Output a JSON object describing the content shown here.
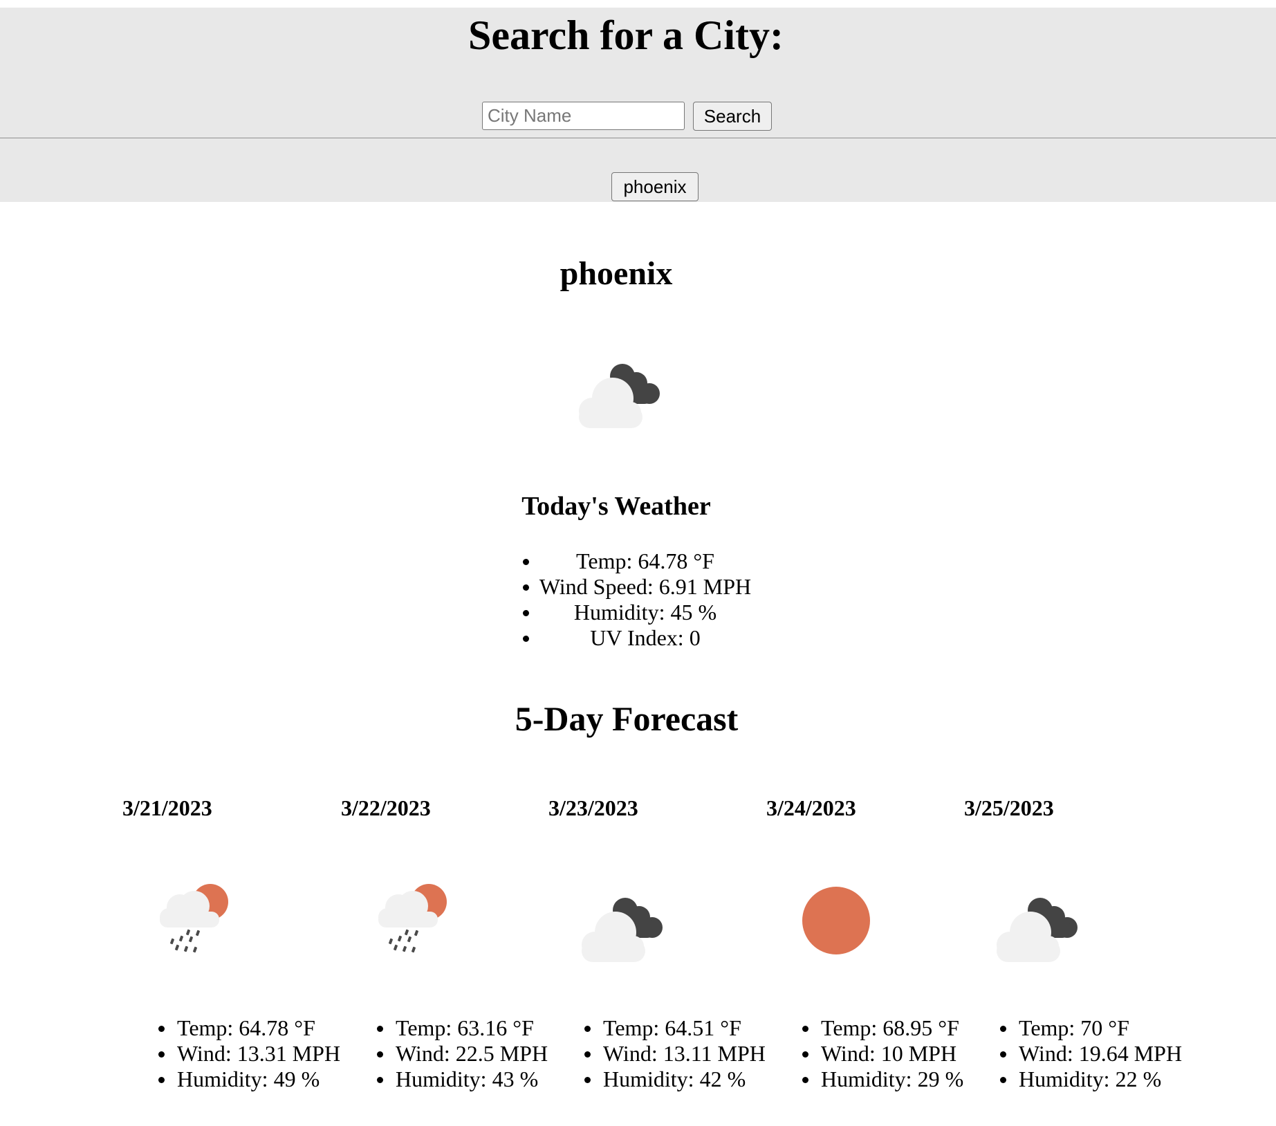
{
  "search": {
    "title": "Search for a City:",
    "placeholder": "City Name",
    "value": "",
    "button_label": "Search"
  },
  "history": [
    {
      "label": "phoenix"
    }
  ],
  "current": {
    "city": "phoenix",
    "icon": "clouds-night-icon",
    "heading": "Today's Weather",
    "temp": "Temp: 64.78 °F",
    "wind": "Wind Speed: 6.91 MPH",
    "humidity": "Humidity: 45 %",
    "uv": "UV Index: 0"
  },
  "forecast_heading": "5-Day Forecast",
  "forecast": [
    {
      "date": "3/21/2023",
      "icon": "rain-sun-icon",
      "temp": "Temp: 64.78 °F",
      "wind": "Wind: 13.31 MPH",
      "humidity": "Humidity: 49 %"
    },
    {
      "date": "3/22/2023",
      "icon": "rain-sun-icon",
      "temp": "Temp: 63.16 °F",
      "wind": "Wind: 22.5 MPH",
      "humidity": "Humidity: 43 %"
    },
    {
      "date": "3/23/2023",
      "icon": "clouds-night-icon",
      "temp": "Temp: 64.51 °F",
      "wind": "Wind: 13.11 MPH",
      "humidity": "Humidity: 42 %"
    },
    {
      "date": "3/24/2023",
      "icon": "sun-icon",
      "temp": "Temp: 68.95 °F",
      "wind": "Wind: 10 MPH",
      "humidity": "Humidity: 29 %"
    },
    {
      "date": "3/25/2023",
      "icon": "clouds-night-icon",
      "temp": "Temp: 70 °F",
      "wind": "Wind: 19.64 MPH",
      "humidity": "Humidity: 22 %"
    }
  ],
  "colors": {
    "header_bg": "#e8e8e8",
    "sun": "#dd7352",
    "cloud_light": "#f1f1f1",
    "cloud_dark": "#444444",
    "rain": "#4a4a4a"
  }
}
